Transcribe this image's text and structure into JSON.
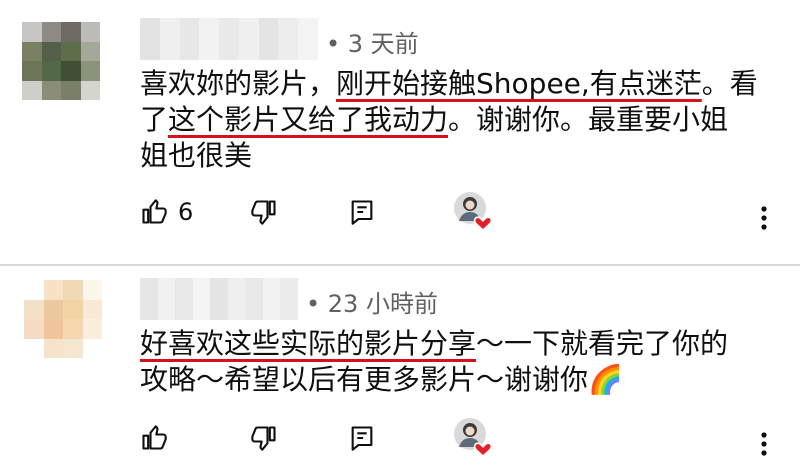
{
  "comments": [
    {
      "meta": "• 3 天前",
      "lines": [
        [
          {
            "t": "喜欢妳的影片，",
            "u": false
          },
          {
            "t": "刚开始接触Shopee,有点迷茫",
            "u": true
          },
          {
            "t": "。看",
            "u": false
          }
        ],
        [
          {
            "t": "了",
            "u": false
          },
          {
            "t": "这个影片又给了我动力",
            "u": true
          },
          {
            "t": "。谢谢你。最重要小姐",
            "u": false
          }
        ],
        [
          {
            "t": "姐也很美",
            "u": false
          }
        ]
      ],
      "like_count": "6"
    },
    {
      "meta": "• 23 小時前",
      "lines": [
        [
          {
            "t": "好喜欢这些实际的影片分享",
            "u": true
          },
          {
            "t": "～一下就看完了你的",
            "u": false
          }
        ],
        [
          {
            "t": "攻略～希望以后有更多影片～谢谢你🌈",
            "u": false
          }
        ]
      ],
      "like_count": ""
    }
  ],
  "colors": {
    "underline": "#d8101b",
    "meta_text": "#606060",
    "heart": "#e3202a",
    "avatar1": [
      "#c8c6c4",
      "#8e8a86",
      "#6f6a64",
      "#bdbab7",
      "#7b7f64",
      "#54604a",
      "#5d6e4b",
      "#a4a89a",
      "#6e7658",
      "#526947",
      "#3f5036",
      "#8b947b",
      "#cfcfca",
      "#8a8d78",
      "#7a8068",
      "#d5d4cf"
    ],
    "avatar2": [
      "#ffffff",
      "#f7e2c7",
      "#f1d9b5",
      "#fdf6ea",
      "#f3e0c6",
      "#e9c99d",
      "#f3d4a5",
      "#f8ead6",
      "#f6dcc2",
      "#f0c59b",
      "#f7d7ad",
      "#fbeedd",
      "#ffffff",
      "#f6e3c9",
      "#f5e6d0",
      "#ffffff"
    ],
    "name1": [
      "#e3e3e3",
      "#efefef",
      "#e7e7e7",
      "#f2f2f2",
      "#e9e9e9",
      "#f0f0f0",
      "#e4e4e4",
      "#ededed",
      "#f3f3f3"
    ],
    "name2": [
      "#e6e6e6",
      "#f1f1f1",
      "#e9e9e9",
      "#f3f3f3",
      "#e5e5e5",
      "#efefef",
      "#e8e8e8",
      "#f2f2f2",
      "#ebebeb"
    ]
  },
  "icons": [
    "thumb-up-icon",
    "thumb-down-icon",
    "reply-icon",
    "creator-heart-icon",
    "more-vert-icon"
  ]
}
